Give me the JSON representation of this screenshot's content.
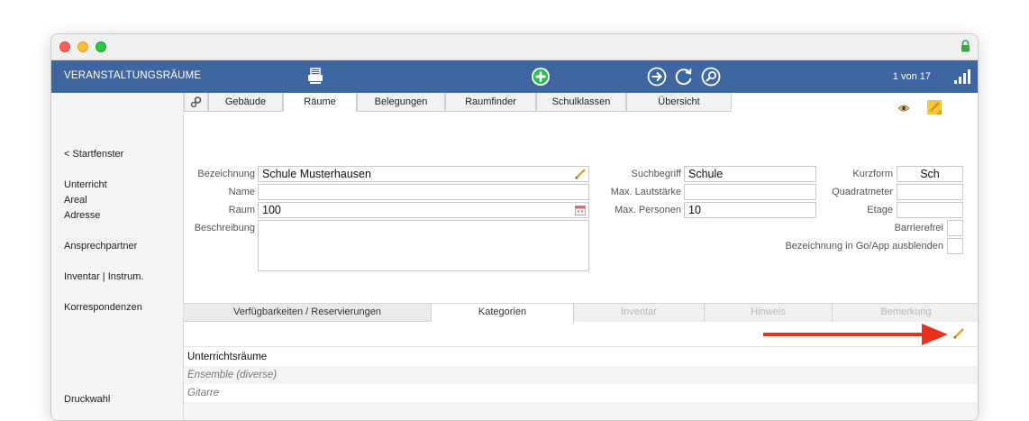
{
  "toolbar": {
    "title": "VERANSTALTUNGSRÄUME",
    "record_counter": "1 von 17",
    "icons": [
      "print-icon",
      "add-icon",
      "next-icon",
      "refresh-icon",
      "search-icon",
      "stats-icon"
    ],
    "accent_color": "#3e67a1"
  },
  "sidebar": {
    "items": [
      "< Startfenster",
      "Unterricht",
      "Areal",
      "Adresse",
      "Ansprechpartner",
      "Inventar | Instrum.",
      "Korrespondenzen",
      "Druckwahl"
    ]
  },
  "tabs": [
    "Gebäude",
    "Räume",
    "Belegungen",
    "Raumfinder",
    "Schulklassen",
    "Übersicht"
  ],
  "active_tab": "Räume",
  "form": {
    "bezeichnung_label": "Bezeichnung",
    "bezeichnung_value": "Schule Musterhausen",
    "name_label": "Name",
    "name_value": "",
    "raum_label": "Raum",
    "raum_value": "100",
    "beschreibung_label": "Beschreibung",
    "beschreibung_value": "",
    "suchbegriff_label": "Suchbegriff",
    "suchbegriff_value": "Schule",
    "lautstaerke_label": "Max. Lautstärke",
    "lautstaerke_value": "",
    "personen_label": "Max. Personen",
    "personen_value": "10",
    "kurzform_label": "Kurzform",
    "kurzform_value": "Sch",
    "quadratmeter_label": "Quadratmeter",
    "quadratmeter_value": "",
    "etage_label": "Etage",
    "etage_value": "",
    "barrierefrei_label": "Barrierefrei",
    "goapp_label": "Bezeichnung in Go/App ausblenden"
  },
  "subtabs": [
    {
      "label": "Verfügbarkeiten / Reservierungen",
      "state": "normal"
    },
    {
      "label": "Kategorien",
      "state": "active"
    },
    {
      "label": "Inventar",
      "state": "disabled"
    },
    {
      "label": "Hinweis",
      "state": "disabled"
    },
    {
      "label": "Bemerkung",
      "state": "disabled"
    }
  ],
  "categories": [
    "Unterrichtsräume",
    "Ensemble (diverse)",
    "Gitarre"
  ],
  "annotation_arrow_color": "#e8321e"
}
